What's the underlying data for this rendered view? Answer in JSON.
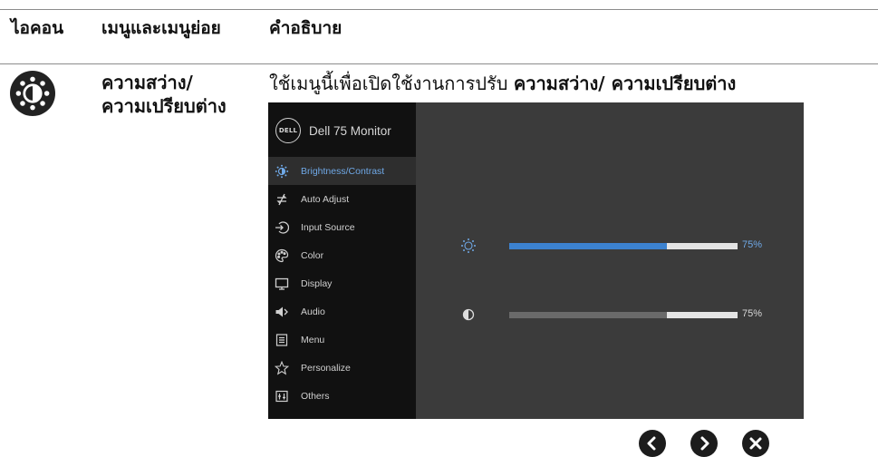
{
  "header": {
    "col_icon": "ไอคอน",
    "col_menu": "เมนูและเมนูย่อย",
    "col_desc": "คำอธิบาย"
  },
  "row": {
    "icon": "brightness-contrast-icon",
    "menu_name": "ความสว่าง/ ความเปรียบต่าง",
    "desc_prefix": "ใช้เมนูนี้เพื่อเปิดใช้งานการปรับ",
    "desc_bold": "ความสว่าง/ ความเปรียบต่าง"
  },
  "osd": {
    "title": "Dell 75 Monitor",
    "logo_text": "DELL",
    "items": [
      {
        "label": "Brightness/Contrast",
        "icon": "brightness-icon",
        "active": true
      },
      {
        "label": "Auto Adjust",
        "icon": "auto-adjust-icon",
        "active": false
      },
      {
        "label": "Input Source",
        "icon": "input-source-icon",
        "active": false
      },
      {
        "label": "Color",
        "icon": "color-palette-icon",
        "active": false
      },
      {
        "label": "Display",
        "icon": "display-icon",
        "active": false
      },
      {
        "label": "Audio",
        "icon": "speaker-icon",
        "active": false
      },
      {
        "label": "Menu",
        "icon": "menu-list-icon",
        "active": false
      },
      {
        "label": "Personalize",
        "icon": "star-icon",
        "active": false
      },
      {
        "label": "Others",
        "icon": "others-icon",
        "active": false
      }
    ],
    "brightness": {
      "value": 0.69,
      "label": "75%",
      "color": "#3c82d0"
    },
    "contrast": {
      "value": 0.69,
      "label": "75%",
      "color": "#6a6a6a"
    },
    "accent_color": "#6fa8e6"
  },
  "nav": [
    {
      "icon": "chevron-left-icon"
    },
    {
      "icon": "chevron-right-icon"
    },
    {
      "icon": "close-icon"
    }
  ]
}
